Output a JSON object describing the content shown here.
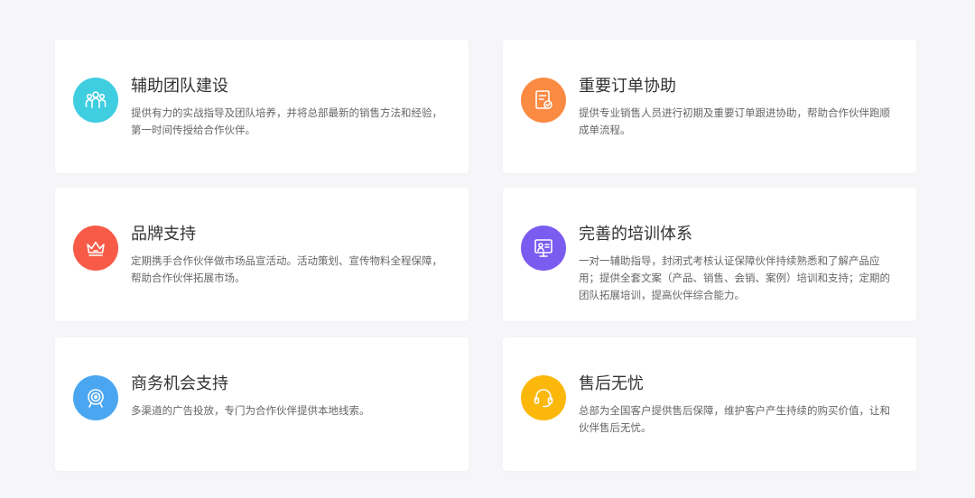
{
  "cards": [
    {
      "title": "辅助团队建设",
      "desc": "提供有力的实战指导及团队培养，并将总部最新的销售方法和经验，第一时间传授给合作伙伴。",
      "icon": "team-icon",
      "color": "#3fcde0"
    },
    {
      "title": "重要订单协助",
      "desc": "提供专业销售人员进行初期及重要订单跟进协助，帮助合作伙伴跑顺成单流程。",
      "icon": "order-icon",
      "color": "#fb8a42"
    },
    {
      "title": "品牌支持",
      "desc": "定期携手合作伙伴做市场品宣活动。活动策划、宣传物料全程保障，帮助合作伙伴拓展市场。",
      "icon": "crown-icon",
      "color": "#f75b48"
    },
    {
      "title": "完善的培训体系",
      "desc": "一对一辅助指导，封闭式考核认证保障伙伴持续熟悉和了解产品应用；提供全套文案（产品、销售、会销、案例）培训和支持；定期的团队拓展培训，提高伙伴综合能力。",
      "icon": "training-icon",
      "color": "#7b5cf0"
    },
    {
      "title": "商务机会支持",
      "desc": "多渠道的广告投放，专门为合作伙伴提供本地线索。",
      "icon": "target-icon",
      "color": "#4aa6f0"
    },
    {
      "title": "售后无忧",
      "desc": "总部为全国客户提供售后保障，维护客户产生持续的购买价值，让和伙伴售后无忧。",
      "icon": "headset-icon",
      "color": "#fbb70a"
    }
  ]
}
